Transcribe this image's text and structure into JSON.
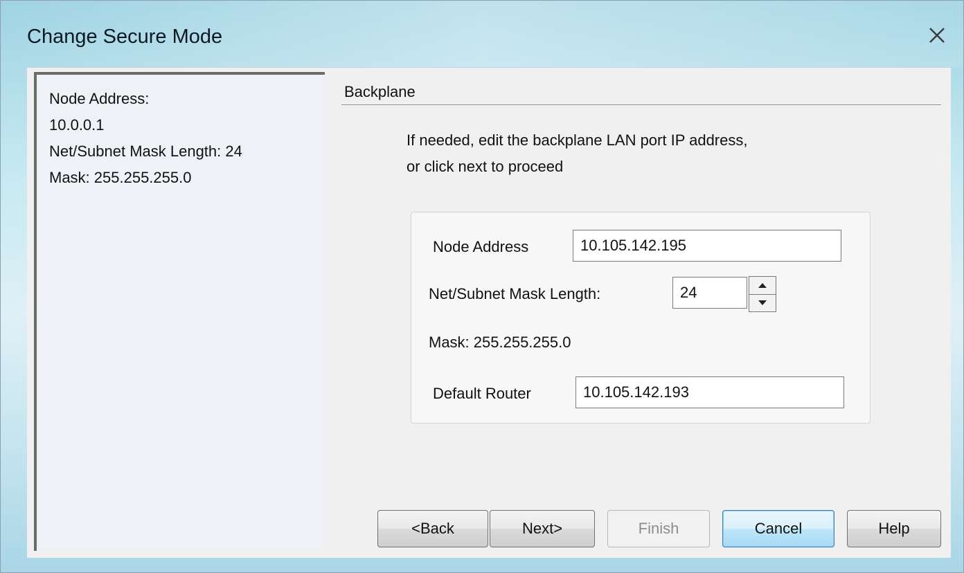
{
  "window": {
    "title": "Change Secure Mode"
  },
  "info": {
    "lines": [
      "Node Address:",
      "10.0.0.1",
      "Net/Subnet Mask Length: 24",
      "Mask: 255.255.255.0"
    ]
  },
  "section": {
    "title": "Backplane",
    "instructions": [
      "If needed, edit the backplane LAN port IP address,",
      "or click next to proceed"
    ]
  },
  "form": {
    "node_address_label": "Node Address",
    "node_address_value": "10.105.142.195",
    "mask_length_label": "Net/Subnet Mask Length:",
    "mask_length_value": "24",
    "mask_text": "Mask: 255.255.255.0",
    "router_label": "Default Router",
    "router_value": "10.105.142.193"
  },
  "buttons": {
    "back": "<Back",
    "next": "Next>",
    "finish": "Finish",
    "cancel": "Cancel",
    "help": "Help"
  },
  "icons": {
    "close": "close-icon",
    "spin_up": "triangle-up-icon",
    "spin_down": "triangle-down-icon"
  }
}
